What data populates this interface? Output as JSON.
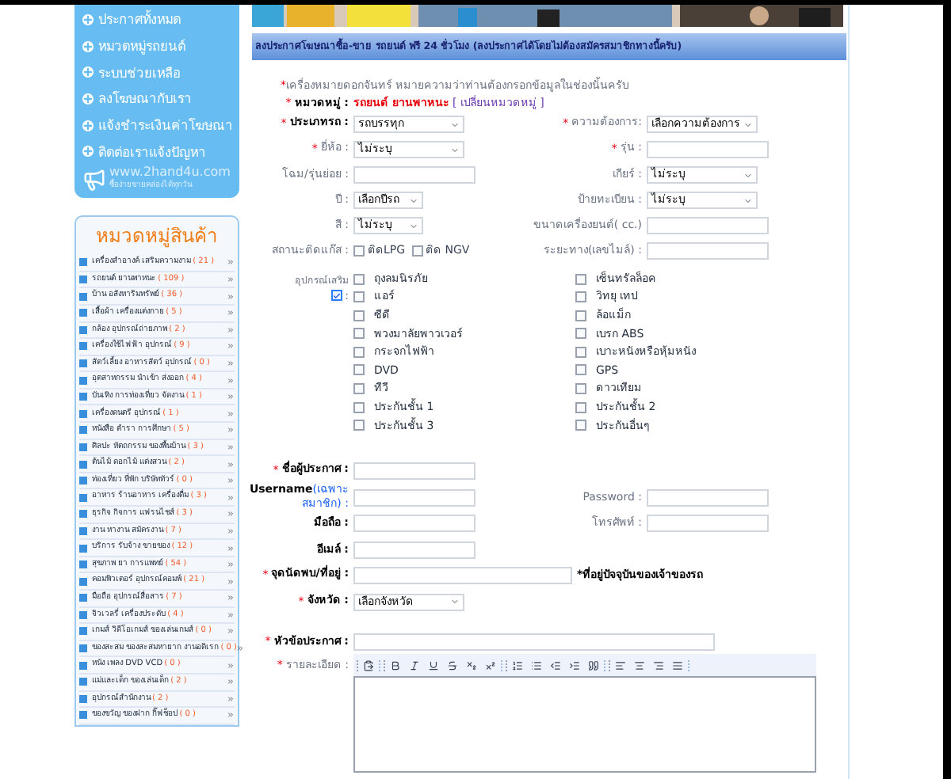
{
  "sidebar": {
    "menu": [
      {
        "label": "ประกาศทั้งหมด"
      },
      {
        "label": "หมวดหมู่รถยนต์"
      },
      {
        "label": "ระบบช่วยเหลือ"
      },
      {
        "label": "ลงโฆษณากับเรา"
      },
      {
        "label": "แจ้งชำระเงินค่าโฆษณา"
      },
      {
        "label": "ติดต่อเราแจ้งปัญหา"
      }
    ],
    "logo": {
      "site": "www.2hand4u.com",
      "tagline": "ซื้อง่ายขายคล่องได้ทุกวัน"
    },
    "categories": {
      "title": "หมวดหมู่สินค้า",
      "items": [
        {
          "name": "เครื่องสำอางค์ เสริมความงาม",
          "count": "( 21 )"
        },
        {
          "name": "รถยนต์ ยานพาหนะ",
          "count": "( 109 )"
        },
        {
          "name": "บ้าน อสังหาริมทรัพย์",
          "count": "( 36 )"
        },
        {
          "name": "เสื้อผ้า เครื่องแต่งกาย",
          "count": "( 5 )"
        },
        {
          "name": "กล้อง อุปกรณ์ถ่ายภาพ",
          "count": "( 2 )"
        },
        {
          "name": "เครื่องใช้ไฟฟ้า อุปกรณ์",
          "count": "( 9 )"
        },
        {
          "name": "สัตว์เลี้ยง อาหารสัตว์ อุปกรณ์",
          "count": "( 0 )"
        },
        {
          "name": "อุตสาหกรรม นำเข้า ส่งออก",
          "count": "( 4 )"
        },
        {
          "name": "บันเทิง การท่องเที่ยว จัดงาน",
          "count": "( 1 )"
        },
        {
          "name": "เครื่องดนตรี อุปกรณ์",
          "count": "( 1 )"
        },
        {
          "name": "หนังสือ ตำรา การศึกษา",
          "count": "( 5 )"
        },
        {
          "name": "ศิลปะ หัตถกรรม ของพื้นบ้าน",
          "count": "( 3 )"
        },
        {
          "name": "ต้นไม้ ดอกไม้ แต่งสวน",
          "count": "( 2 )"
        },
        {
          "name": "ท่องเที่ยว ที่พัก บริษัททัวร์",
          "count": "( 0 )"
        },
        {
          "name": "อาหาร ร้านอาหาร เครื่องดื่ม",
          "count": "( 3 )"
        },
        {
          "name": "ธุรกิจ กิจการ แฟรนไชส์",
          "count": "( 3 )"
        },
        {
          "name": "งาน หางาน สมัครงาน",
          "count": "( 7 )"
        },
        {
          "name": "บริการ รับจ้าง ขายของ",
          "count": "( 12 )"
        },
        {
          "name": "สุขภาพ ยา การแพทย์",
          "count": "( 54 )"
        },
        {
          "name": "คอมพิวเตอร์ อุปกรณ์คอมพ์",
          "count": "( 21 )"
        },
        {
          "name": "มือถือ อุปกรณ์สื่อสาร",
          "count": "( 7 )"
        },
        {
          "name": "จิวเวลรี่ เครื่องประดับ",
          "count": "( 4 )"
        },
        {
          "name": "เกมส์ วิดีโอเกมส์ ของเล่นเกมส์",
          "count": "( 0 )"
        },
        {
          "name": "ของสะสม ของสะสมหายาก งานอดิเรก",
          "count": "( 0 )"
        },
        {
          "name": "หนัง เพลง DVD VCD",
          "count": "( 0 )"
        },
        {
          "name": "แม่และเด็ก ของเล่นเด็ก",
          "count": "( 2 )"
        },
        {
          "name": "อุปกรณ์สำนักงาน",
          "count": "( 2 )"
        },
        {
          "name": "ของขวัญ ของฝาก กิ๊ฟช็อป",
          "count": "( 0 )"
        }
      ]
    }
  },
  "main": {
    "header": "ลงประกาศโฆษณาซื้อ-ขาย รถยนต์ ฟรี 24 ชั่วโมง (ลงประกาศได้โดยไม่ต้องสมัครสมาชิกทางนี้ครับ)",
    "note_mark": "*",
    "note": "เครื่องหมายดอกจันทร์ หมายความว่าท่านต้องกรอกข้อมูลในช่องนั้นครับ",
    "category": {
      "required_mark": "*",
      "label": "หมวดหมู่ :",
      "value": "รถยนต์ ยานพาหนะ",
      "link": "[ เปลี่ยนหมวดหมู่ ]"
    },
    "rows": [
      {
        "cells": [
          {
            "kind": "select",
            "required_mark": "*",
            "label": "ประเภทรถ :",
            "strong": true,
            "value": "รถบรรทุก"
          },
          {
            "kind": "select",
            "required_mark": "*",
            "label": "ความต้องการ:",
            "strong": false,
            "value": "เลือกความต้องการ"
          }
        ]
      },
      {
        "cells": [
          {
            "kind": "select",
            "required_mark": "*",
            "label": "ยี่ห้อ :",
            "strong": false,
            "value": "ไม่ระบุ"
          },
          {
            "kind": "input",
            "required_mark": "*",
            "label": "รุ่น :",
            "strong": false
          }
        ]
      },
      {
        "cells": [
          {
            "kind": "input",
            "label": "โฉม/รุ่นย่อย :",
            "strong": false
          },
          {
            "kind": "select",
            "label": "เกียร์ :",
            "strong": false,
            "value": "ไม่ระบุ"
          }
        ]
      },
      {
        "cells": [
          {
            "kind": "select_small",
            "label": "ปี :",
            "strong": false,
            "value": "เลือกปีรถ"
          },
          {
            "kind": "select",
            "label": "ป้ายทะเบียน :",
            "strong": false,
            "value": "ไม่ระบุ"
          }
        ]
      },
      {
        "cells": [
          {
            "kind": "select_small",
            "label": "สี :",
            "strong": false,
            "value": "ไม่ระบุ"
          },
          {
            "kind": "input",
            "label": "ขนาดเครื่องยนต์( cc.)",
            "strong": false
          }
        ]
      },
      {
        "cells": [
          {
            "kind": "checks",
            "label": "สถานะติดแก๊ส :",
            "strong": false,
            "options": [
              {
                "label": "ติดLPG",
                "checked": false
              },
              {
                "label": "ติด NGV",
                "checked": false
              }
            ]
          },
          {
            "kind": "input",
            "label": "ระยะทาง(เลขไมล์) :",
            "strong": false
          }
        ]
      }
    ],
    "accessories": {
      "label": "อุปกรณ์เสริม",
      "checked": true,
      "suffix": ":",
      "options": [
        {
          "label": "ถุงลมนิรภัย",
          "checked": false
        },
        {
          "label": "เซ็นทรัลล็อค",
          "checked": false
        },
        {
          "label": "แอร์",
          "checked": false
        },
        {
          "label": "วิทยุ เทป",
          "checked": false
        },
        {
          "label": "ซีดี",
          "checked": false
        },
        {
          "label": "ล้อแม็ก",
          "checked": false
        },
        {
          "label": "พวงมาลัยพาวเวอร์",
          "checked": false
        },
        {
          "label": "เบรก ABS",
          "checked": false
        },
        {
          "label": "กระจกไฟฟ้า",
          "checked": false
        },
        {
          "label": "เบาะหนังหรือหุ้มหนัง",
          "checked": false
        },
        {
          "label": "DVD",
          "checked": false
        },
        {
          "label": "GPS",
          "checked": false
        },
        {
          "label": "ทีวี",
          "checked": false
        },
        {
          "label": "ดาวเทียม",
          "checked": false
        },
        {
          "label": "ประกันชั้น 1",
          "checked": false
        },
        {
          "label": "ประกันชั้น 2",
          "checked": false
        },
        {
          "label": "ประกันชั้น 3",
          "checked": false
        },
        {
          "label": "ประกันอื่นๆ",
          "checked": false
        }
      ]
    },
    "contact_rows": [
      {
        "cells": [
          {
            "kind": "input",
            "required_mark": "*",
            "label": "ชื่อผู้ประกาศ :",
            "strong": true
          }
        ]
      },
      {
        "cells": [
          {
            "kind": "input",
            "label": "Username",
            "label_note": "(เฉพาะสมาชิก) :",
            "strong": true
          },
          {
            "kind": "input",
            "label": "Password :",
            "strong": false
          }
        ]
      },
      {
        "cells": [
          {
            "kind": "input",
            "label": "มือถือ :",
            "strong": true
          },
          {
            "kind": "input",
            "label": "โทรศัพท์ :",
            "strong": false
          }
        ]
      },
      {
        "cells": [
          {
            "kind": "input",
            "label": "อีเมล์ :",
            "strong": true
          }
        ]
      },
      {
        "cells": [
          {
            "kind": "address",
            "required_mark": "*",
            "label": "จุดนัดพบ/ที่อยู่ :",
            "strong": true,
            "hint": "*ที่อยู่ปัจจุบันของเจ้าของรถ"
          }
        ]
      },
      {
        "cells": [
          {
            "kind": "select",
            "required_mark": "*",
            "label": "จังหวัด :",
            "strong": true,
            "value": "เลือกจังหวัด"
          }
        ]
      }
    ],
    "title_field": {
      "label": "หัวข้อประกาศ :",
      "required_mark": "*"
    },
    "details_field": {
      "label": "รายละเอียด :",
      "required_mark": "*"
    }
  }
}
